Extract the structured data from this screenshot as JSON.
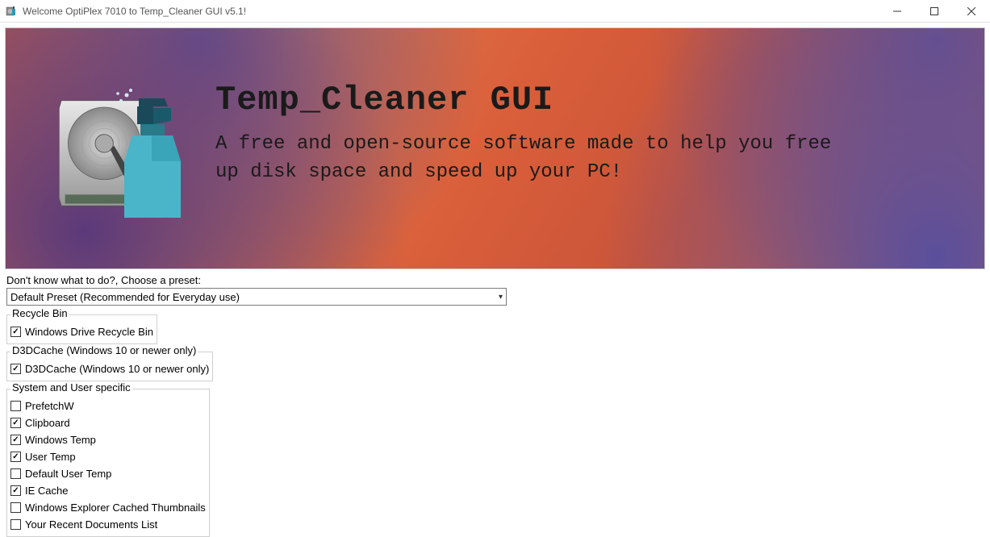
{
  "window": {
    "title": "Welcome OptiPlex 7010 to Temp_Cleaner GUI v5.1!"
  },
  "banner": {
    "title": "Temp_Cleaner GUI",
    "subtitle": "A free and open-source software made to help you free up disk space and speed up your PC!"
  },
  "preset": {
    "label": "Don't know what to do?, Choose a preset:",
    "selected": "Default Preset (Recommended for Everyday use)"
  },
  "groups": [
    {
      "name": "Recycle Bin",
      "items": [
        {
          "label": "Windows Drive Recycle Bin",
          "checked": true
        }
      ]
    },
    {
      "name": "D3DCache (Windows 10 or newer only)",
      "items": [
        {
          "label": "D3DCache (Windows 10 or newer only)",
          "checked": true
        }
      ]
    },
    {
      "name": "System and User specific",
      "items": [
        {
          "label": "PrefetchW",
          "checked": false
        },
        {
          "label": "Clipboard",
          "checked": true
        },
        {
          "label": "Windows Temp",
          "checked": true
        },
        {
          "label": "User Temp",
          "checked": true
        },
        {
          "label": "Default User Temp",
          "checked": false
        },
        {
          "label": "IE Cache",
          "checked": true
        },
        {
          "label": "Windows Explorer Cached Thumbnails",
          "checked": false
        },
        {
          "label": "Your Recent Documents List",
          "checked": false
        }
      ]
    }
  ]
}
